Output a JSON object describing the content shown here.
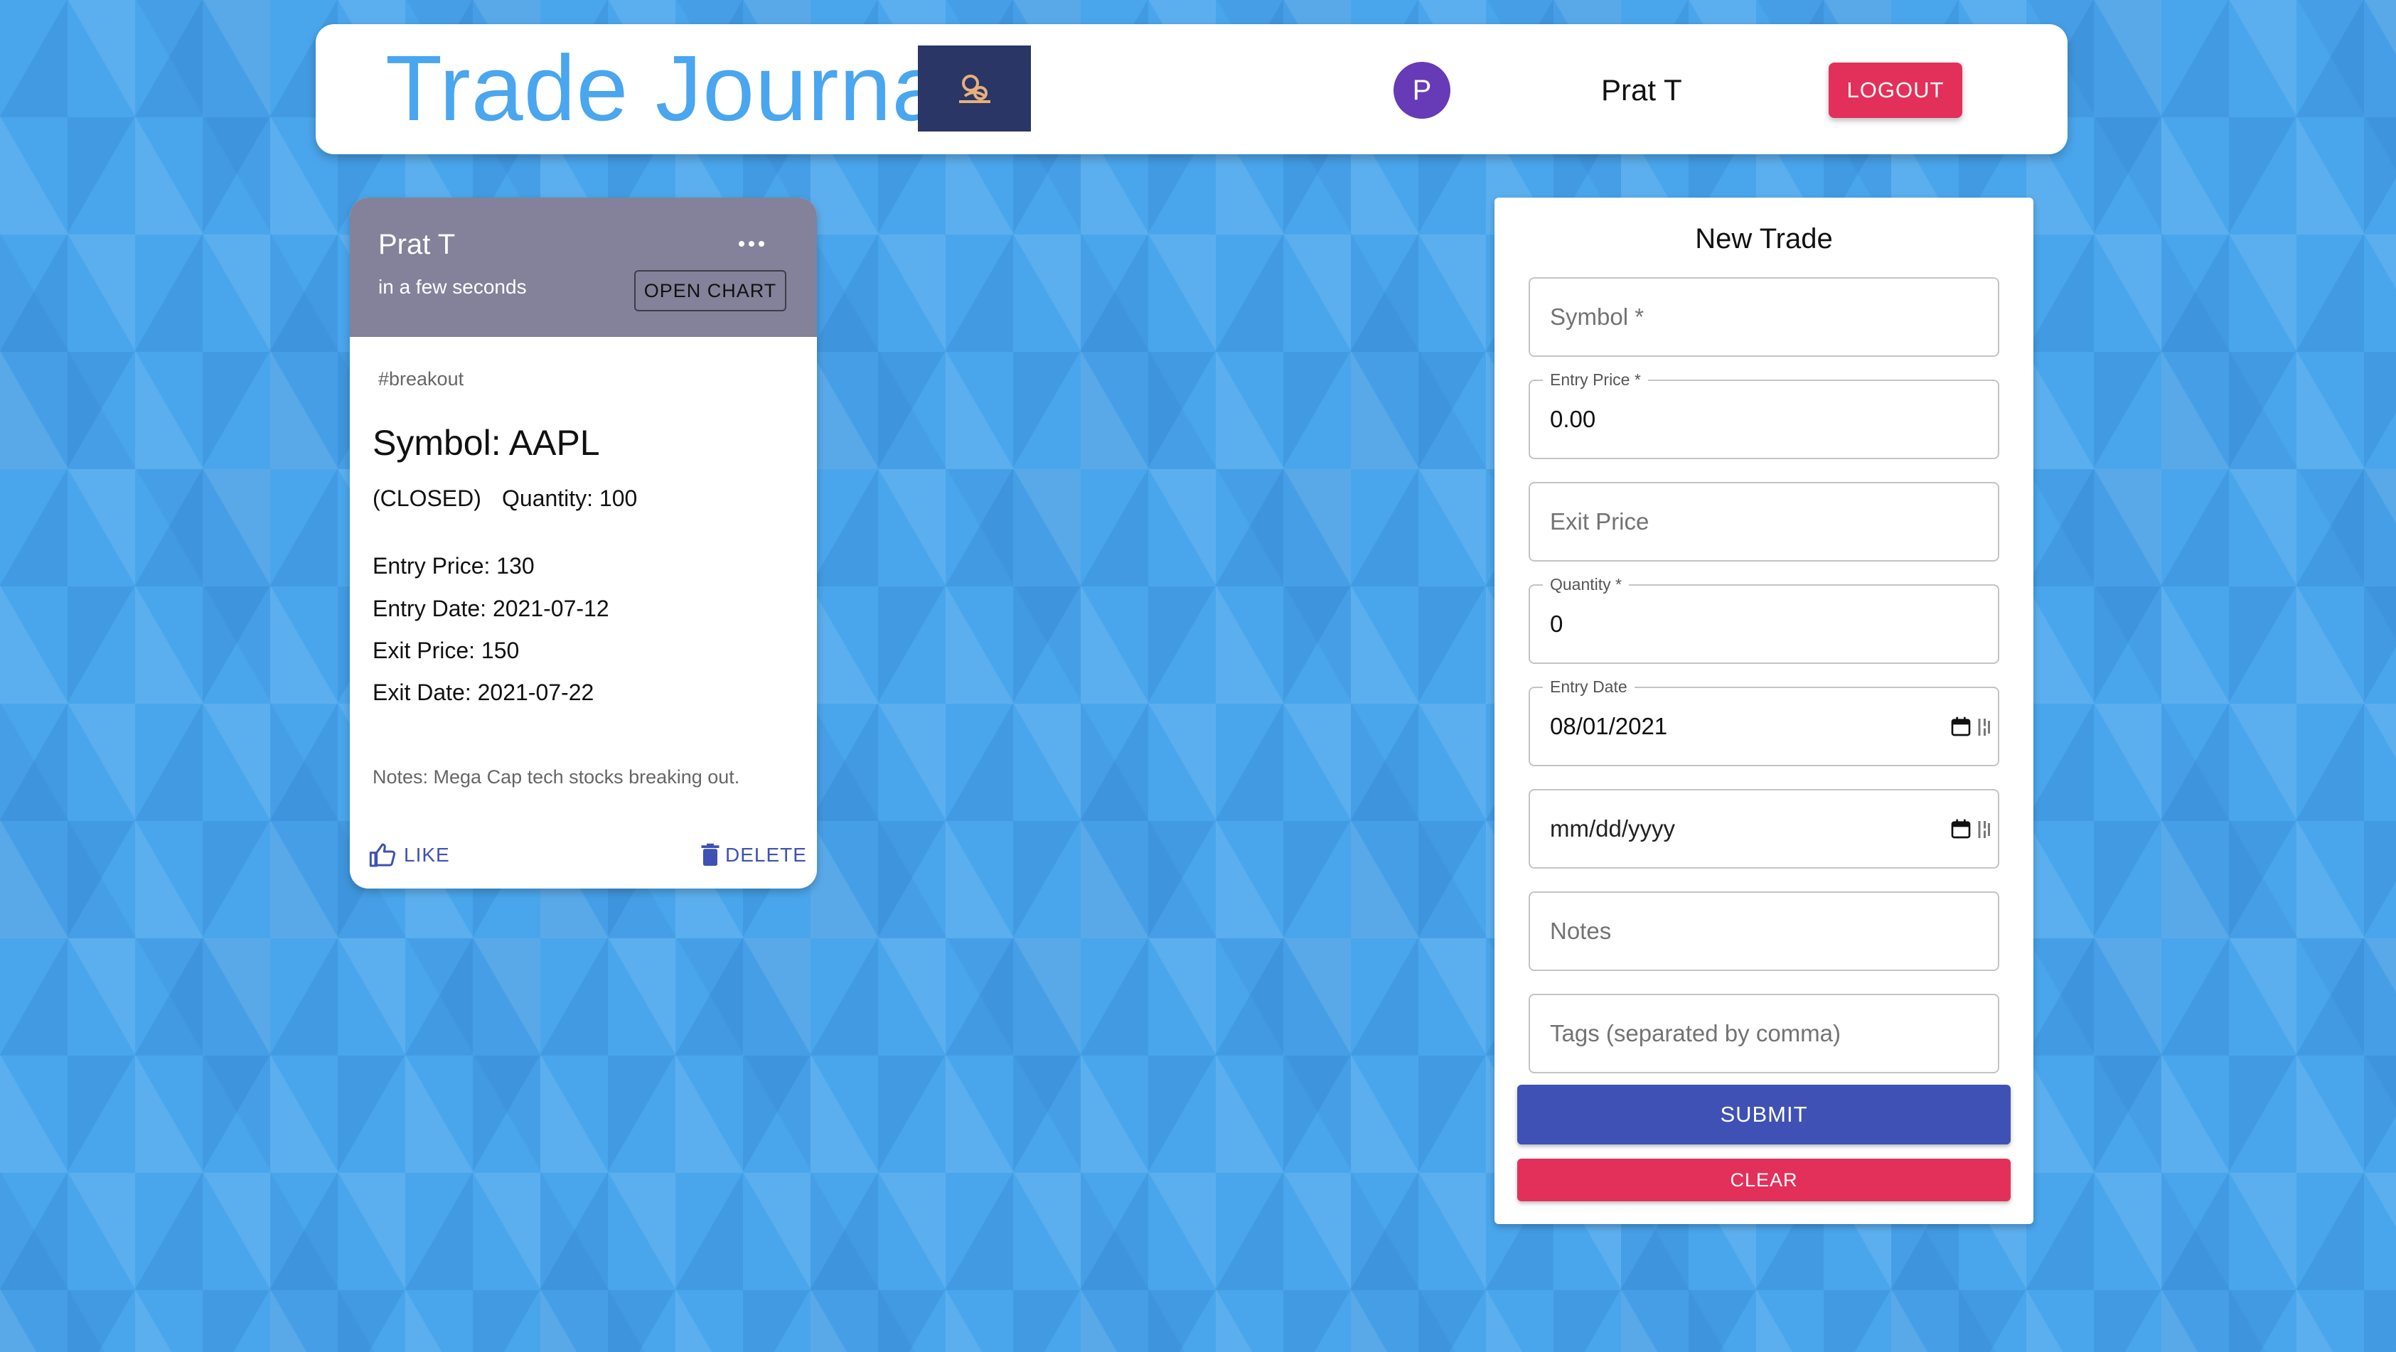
{
  "header": {
    "title": "Trade Journal",
    "logo_icon": "trading-logo-icon",
    "avatar_initial": "P",
    "user_name": "Prat T",
    "logout_label": "LOGOUT"
  },
  "colors": {
    "title": "#4aa6ee",
    "logo_bg": "#2a3666",
    "avatar": "#673ab7",
    "logout": "#e3305a",
    "card_header": "#83829a",
    "submit": "#3f51b5",
    "clear": "#e3305a",
    "link": "#3f51b5"
  },
  "trade_card": {
    "user": "Prat T",
    "time": "in a few seconds",
    "open_chart_label": "OPEN CHART",
    "tag": "#breakout",
    "symbol": "Symbol: AAPL",
    "status": "(CLOSED)",
    "quantity": "Quantity: 100",
    "entry_price": "Entry Price: 130",
    "entry_date": "Entry Date: 2021-07-12",
    "exit_price": "Exit Price: 150",
    "exit_date": "Exit Date: 2021-07-22",
    "notes": "Notes: Mega Cap tech stocks breaking out.",
    "like_label": "LIKE",
    "delete_label": "DELETE"
  },
  "form": {
    "title": "New Trade",
    "symbol_placeholder": "Symbol *",
    "entry_price_label": "Entry Price *",
    "entry_price_value": "0.00",
    "exit_price_placeholder": "Exit Price",
    "quantity_label": "Quantity *",
    "quantity_value": "0",
    "entry_date_label": "Entry Date",
    "entry_date_value": "08/01/2021",
    "exit_date_value": "mm/dd/yyyy",
    "notes_placeholder": "Notes",
    "tags_placeholder": "Tags (separated by comma)",
    "submit_label": "SUBMIT",
    "clear_label": "CLEAR"
  }
}
